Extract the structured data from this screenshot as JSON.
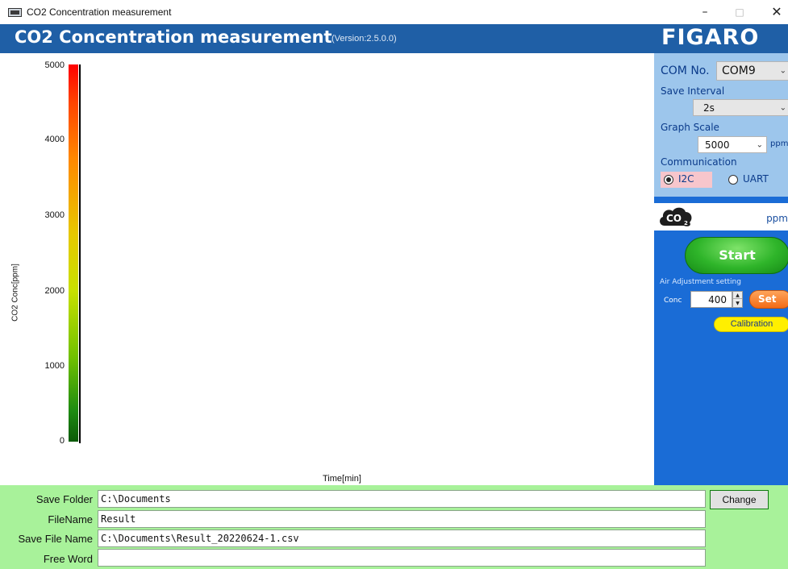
{
  "window": {
    "title": "CO2 Concentration measurement",
    "minimize": "–",
    "maximize": "□",
    "close": "✕"
  },
  "header": {
    "title": "CO2 Concentration measurement",
    "version": "(Version:2.5.0.0)",
    "brand": "FIGARO"
  },
  "graph": {
    "y_label": "CO2 Conc[ppm]",
    "x_label": "Time[min]",
    "ticks": [
      "5000",
      "4000",
      "3000",
      "2000",
      "1000",
      "0"
    ],
    "colors": {
      "high": "#ff0000",
      "mid": "#e6c800",
      "low": "#0c5a08"
    }
  },
  "panel": {
    "com_label": "COM No.",
    "com_value": "COM9",
    "save_interval_label": "Save Interval",
    "save_interval_value": "2s",
    "graph_scale_label": "Graph Scale",
    "graph_scale_value": "5000",
    "graph_scale_unit": "ppm",
    "communication_label": "Communication",
    "option_i2c": "I2C",
    "option_uart": "UART",
    "selected_communication": "I2C",
    "readout_unit": "ppm",
    "start_label": "Start",
    "air_adjust_title": "Air Adjustment setting",
    "conc_label": "Conc",
    "conc_value": "400",
    "set_label": "Set",
    "calibration_label": "Calibration",
    "colors": {
      "panel_blue": "#1a6cd6",
      "panel_top": "#9dc6ec",
      "start_green": "#2fb52a",
      "set_orange": "#f36b16",
      "calibration_yellow": "#ffef00"
    }
  },
  "files": {
    "save_folder_label": "Save Folder",
    "save_folder_value": "C:\\Documents",
    "filename_label": "FileName",
    "filename_value": "Result",
    "save_file_name_label": "Save File Name",
    "save_file_name_value": "C:\\Documents\\Result_20220624-1.csv",
    "free_word_label": "Free Word",
    "free_word_value": "",
    "change_label": "Change",
    "background": "#a8f29a"
  }
}
